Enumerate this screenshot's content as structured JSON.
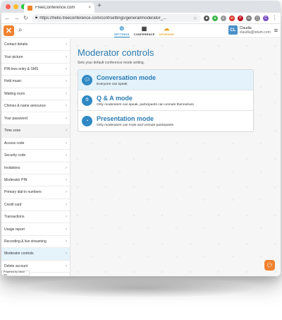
{
  "browser": {
    "tab_title": "FreeConference.com",
    "tab_close": "×",
    "new_tab": "+",
    "url": "https://hello.freeconference.com/conf/settings/general/moderator_...",
    "lights": [
      "#ff5f57",
      "#febc2e",
      "#28c840"
    ]
  },
  "app": {
    "logo_glyph": "✕",
    "nav": [
      {
        "label": "SETTINGS",
        "icon": "gear-icon"
      },
      {
        "label": "CONFERENCE",
        "icon": "calendar-icon"
      },
      {
        "label": "UPGRADE",
        "icon": "cloud-icon"
      }
    ],
    "user": {
      "initials": "CL",
      "name": "Claudia",
      "email": "claudia@iotum.com"
    }
  },
  "sidebar": {
    "items": [
      {
        "label": "Contact details"
      },
      {
        "label": "Your picture"
      },
      {
        "label": "PIN-less entry & SMS"
      },
      {
        "label": "Hold music"
      },
      {
        "label": "Waiting room"
      },
      {
        "label": "Chimes & name announce"
      },
      {
        "label": "Your password"
      },
      {
        "label": "Time zone"
      },
      {
        "label": "Access code"
      },
      {
        "label": "Security code"
      },
      {
        "label": "Invitations"
      },
      {
        "label": "Moderator PIN"
      },
      {
        "label": "Primary dial-in numbers"
      },
      {
        "label": "Credit card"
      },
      {
        "label": "Transactions"
      },
      {
        "label": "Usage report"
      },
      {
        "label": "Recording & live streaming"
      },
      {
        "label": "Moderator controls"
      },
      {
        "label": "Delete account"
      }
    ],
    "powered_by": "Powered by iotum inc."
  },
  "main": {
    "title": "Moderator controls",
    "subtitle": "Sets your default conference mode setting.",
    "options": [
      {
        "title": "Conversation mode",
        "desc": "Everyone can speak",
        "icon": "chat-bubbles-icon"
      },
      {
        "title": "Q & A mode",
        "desc": "Only moderators can speak, participants can unmute themselves",
        "icon": "hand-raise-icon"
      },
      {
        "title": "Presentation mode",
        "desc": "Only moderators can mute and unmute participants",
        "icon": "presentation-icon"
      }
    ]
  },
  "colors": {
    "accent": "#2b7cb4",
    "brand_orange": "#f0812f",
    "selected_bg": "#e3f2fb",
    "upgrade": "#e8a21b"
  }
}
